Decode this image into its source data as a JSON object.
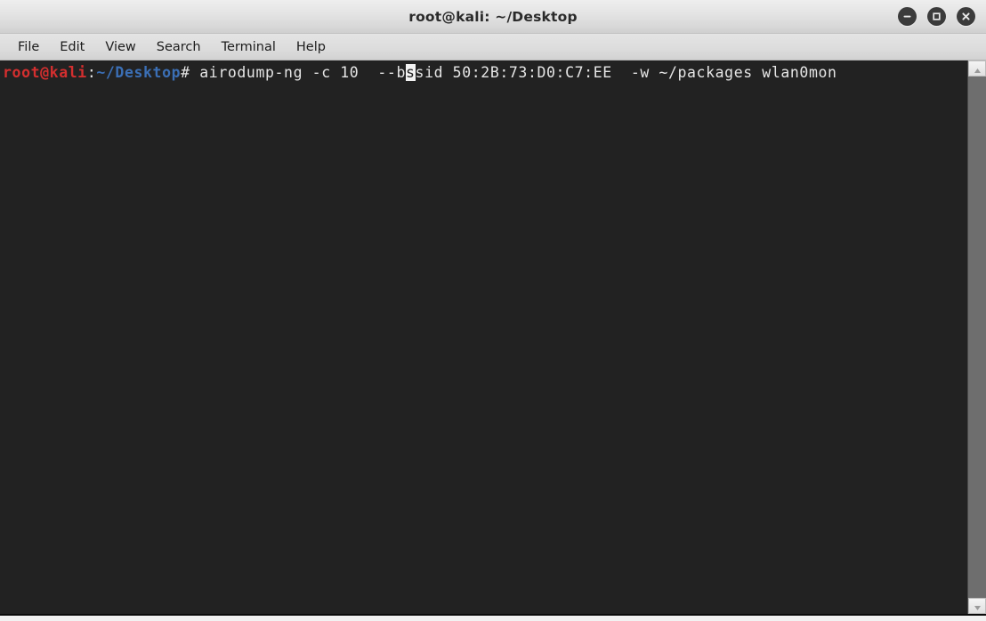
{
  "window": {
    "title": "root@kali: ~/Desktop",
    "controls": [
      {
        "name": "minimize",
        "glyph": "minimize-icon"
      },
      {
        "name": "maximize",
        "glyph": "maximize-icon"
      },
      {
        "name": "close",
        "glyph": "close-icon"
      }
    ]
  },
  "menubar": {
    "items": [
      {
        "label": "File"
      },
      {
        "label": "Edit"
      },
      {
        "label": "View"
      },
      {
        "label": "Search"
      },
      {
        "label": "Terminal"
      },
      {
        "label": "Help"
      }
    ]
  },
  "terminal": {
    "prompt": {
      "user_host": "root@kali",
      "colon": ":",
      "path": "~/Desktop",
      "sigil": "# "
    },
    "command": {
      "before_cursor": "airodump-ng -c 10  --b",
      "cursor_char": "s",
      "after_cursor": "sid 50:2B:73:D0:C7:EE  -w ~/packages wlan0mon"
    },
    "full_command": "airodump-ng -c 10  --bssid 50:2B:73:D0:C7:EE  -w ~/packages wlan0mon"
  },
  "scrollbar": {
    "up_label": "scroll-up",
    "down_label": "scroll-down"
  },
  "colors": {
    "terminal_bg": "#222222",
    "prompt_user": "#d42f2f",
    "prompt_path": "#3b6fb5",
    "foreground": "#e6e6e6",
    "titlebar_bg": "#e3e3e3",
    "scrollbar_trough": "#6e6e6e"
  }
}
